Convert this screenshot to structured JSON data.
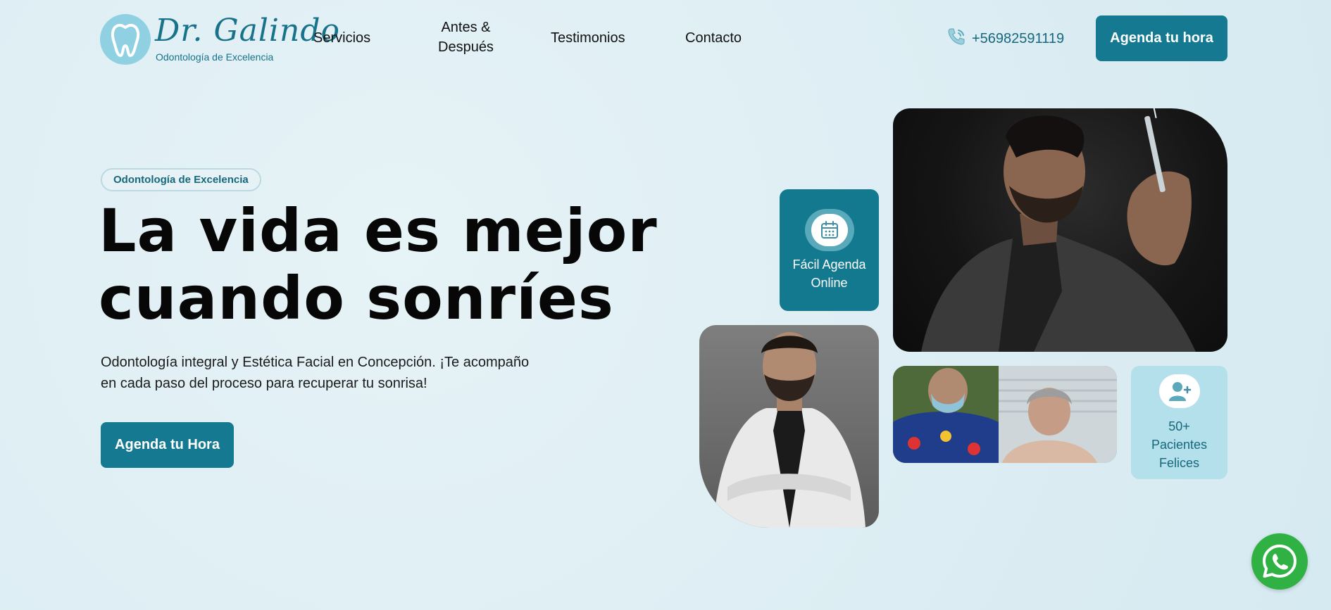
{
  "header": {
    "logo": {
      "name": "Dr. Galindo",
      "tagline": "Odontología de Excelencia"
    },
    "nav": [
      {
        "label": "Servicios"
      },
      {
        "label_line1": "Antes &",
        "label_line2": "Después"
      },
      {
        "label": "Testimonios"
      },
      {
        "label": "Contacto"
      }
    ],
    "phone": "+56982591119",
    "cta": "Agenda tu hora"
  },
  "hero": {
    "pill": "Odontología de Excelencia",
    "title_line1": "La vida es mejor",
    "title_line2": "cuando sonríes",
    "description": "Odontología integral y Estética Facial en Concepción. ¡Te acompaño en cada paso del proceso para recuperar tu sonrisa!",
    "cta": "Agenda tu Hora"
  },
  "badges": {
    "agenda": {
      "line1": "Fácil Agenda",
      "line2": "Online",
      "icon": "calendar-icon"
    },
    "patients": {
      "line1": "50+",
      "line2": "Pacientes",
      "line3": "Felices",
      "icon": "user-plus-icon"
    }
  },
  "colors": {
    "accent": "#157a91",
    "background": "#ddeef4",
    "badge_light": "#b3e0eb",
    "whatsapp": "#2fb144"
  }
}
